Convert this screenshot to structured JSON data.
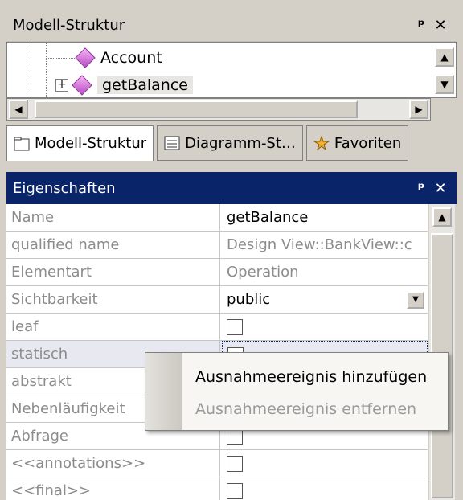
{
  "model_panel": {
    "title": "Modell-Struktur",
    "pin_glyph": "ᵖ",
    "close_glyph": "✕",
    "tree_items": [
      {
        "label": "Account",
        "icon": "operation-diamond-icon"
      },
      {
        "label": "getBalance",
        "icon": "operation-diamond-icon",
        "expander": "+"
      }
    ]
  },
  "tabs": [
    {
      "label": "Modell-Struktur",
      "icon": "folder-icon"
    },
    {
      "label": "Diagramm-St…",
      "icon": "diagram-tree-icon"
    },
    {
      "label": "Favoriten",
      "icon": "favorites-star-icon"
    }
  ],
  "properties_panel": {
    "title": "Eigenschaften",
    "pin_glyph": "ᵖ",
    "close_glyph": "✕",
    "rows": [
      {
        "name": "Name",
        "value": "getBalance"
      },
      {
        "name": "qualified name",
        "value": "Design View::BankView::c"
      },
      {
        "name": "Elementart",
        "value": "Operation"
      },
      {
        "name": "Sichtbarkeit",
        "value": "public"
      },
      {
        "name": "leaf",
        "value": ""
      },
      {
        "name": "statisch",
        "value": ""
      },
      {
        "name": "abstrakt",
        "value": ""
      },
      {
        "name": "Nebenläufigkeit",
        "value": ""
      },
      {
        "name": "Abfrage",
        "value": ""
      },
      {
        "name": "<<annotations>>",
        "value": ""
      },
      {
        "name": "<<final>>",
        "value": ""
      }
    ]
  },
  "context_menu": {
    "items": [
      {
        "label": "Ausnahmeereignis hinzufügen",
        "enabled": true
      },
      {
        "label": "Ausnahmeereignis entfernen",
        "enabled": false
      }
    ]
  },
  "colors": {
    "active_titlebar": "#0a246a",
    "diamond": "#c86fd4"
  }
}
